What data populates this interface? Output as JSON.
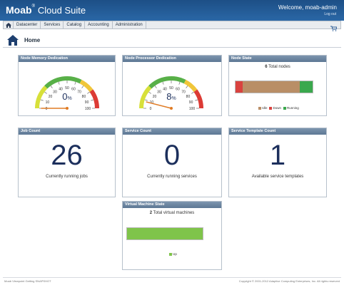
{
  "header": {
    "logo_brand": "Moab",
    "logo_mark": "®",
    "logo_suite": "Cloud Suite",
    "welcome": "Welcome, moab-admin",
    "logout": "Log out"
  },
  "nav": {
    "home_icon": "home-icon",
    "items": [
      "Datacenter",
      "Services",
      "Catalog",
      "Accounting",
      "Administration"
    ],
    "cart_icon": "cart-icon"
  },
  "page": {
    "title": "Home",
    "icon": "house-icon"
  },
  "panels": {
    "memory": {
      "title": "Node Memory Dedication",
      "value": 0,
      "value_text": "0",
      "unit": "%",
      "ticks": [
        "0",
        "10",
        "20",
        "30",
        "40",
        "50",
        "60",
        "70",
        "80",
        "90",
        "100"
      ]
    },
    "processor": {
      "title": "Node Processor Dedication",
      "value": 8,
      "value_text": "8",
      "unit": "%",
      "ticks": [
        "0",
        "10",
        "20",
        "30",
        "40",
        "50",
        "60",
        "70",
        "80",
        "90",
        "100"
      ]
    },
    "node_state": {
      "title": "Node State",
      "total": "6",
      "total_label": "Total nodes",
      "segments": [
        {
          "label": "Down",
          "fraction": 0.09,
          "color": "#d9423f"
        },
        {
          "label": "Idle",
          "fraction": 0.74,
          "color": "#b98e66"
        },
        {
          "label": "Running",
          "fraction": 0.17,
          "color": "#3aa84d"
        }
      ],
      "legend": [
        {
          "label": "Idle",
          "color": "#b98e66"
        },
        {
          "label": "Down",
          "color": "#d9423f"
        },
        {
          "label": "Running",
          "color": "#3aa84d"
        }
      ]
    },
    "job_count": {
      "title": "Job Count",
      "value": "26",
      "caption": "Currently running jobs"
    },
    "service_count": {
      "title": "Service Count",
      "value": "0",
      "caption": "Currently running services"
    },
    "service_template_count": {
      "title": "Service Template Count",
      "value": "1",
      "caption": "Available service templates"
    },
    "vm_state": {
      "title": "Virtual Machine State",
      "total": "2",
      "total_label": "Total virtual machines",
      "segments": [
        {
          "label": "Up",
          "fraction": 1.0,
          "color": "#7fc44a"
        }
      ],
      "legend": [
        {
          "label": "Up",
          "color": "#7fc44a"
        }
      ]
    }
  },
  "footer": {
    "left": "Moab Viewpoint Getting SNAPSHOT",
    "right": "Copyright © 2001-2012 Adaptive Computing Enterprises, Inc. All rights reserved"
  }
}
